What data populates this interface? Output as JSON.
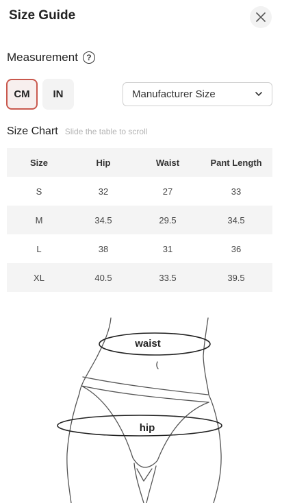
{
  "header": {
    "title": "Size Guide",
    "close_icon": "close-icon"
  },
  "measurement": {
    "label": "Measurement",
    "help_icon": "question-circle-icon",
    "help_glyph": "?"
  },
  "units": {
    "cm_label": "CM",
    "in_label": "IN",
    "selected": "CM"
  },
  "size_select": {
    "value": "Manufacturer Size",
    "icon": "chevron-down-icon"
  },
  "chart": {
    "title": "Size Chart",
    "hint": "Slide the table to scroll"
  },
  "table": {
    "columns": [
      "Size",
      "Hip",
      "Waist",
      "Pant Length"
    ],
    "rows": [
      [
        "S",
        "32",
        "27",
        "33"
      ],
      [
        "M",
        "34.5",
        "29.5",
        "34.5"
      ],
      [
        "L",
        "38",
        "31",
        "36"
      ],
      [
        "XL",
        "40.5",
        "33.5",
        "39.5"
      ]
    ]
  },
  "figure": {
    "waist_label": "waist",
    "hip_label": "hip"
  },
  "colors": {
    "accent": "#c9584d",
    "row_shade": "#f4f4f4",
    "hint": "#b3b3b3"
  }
}
